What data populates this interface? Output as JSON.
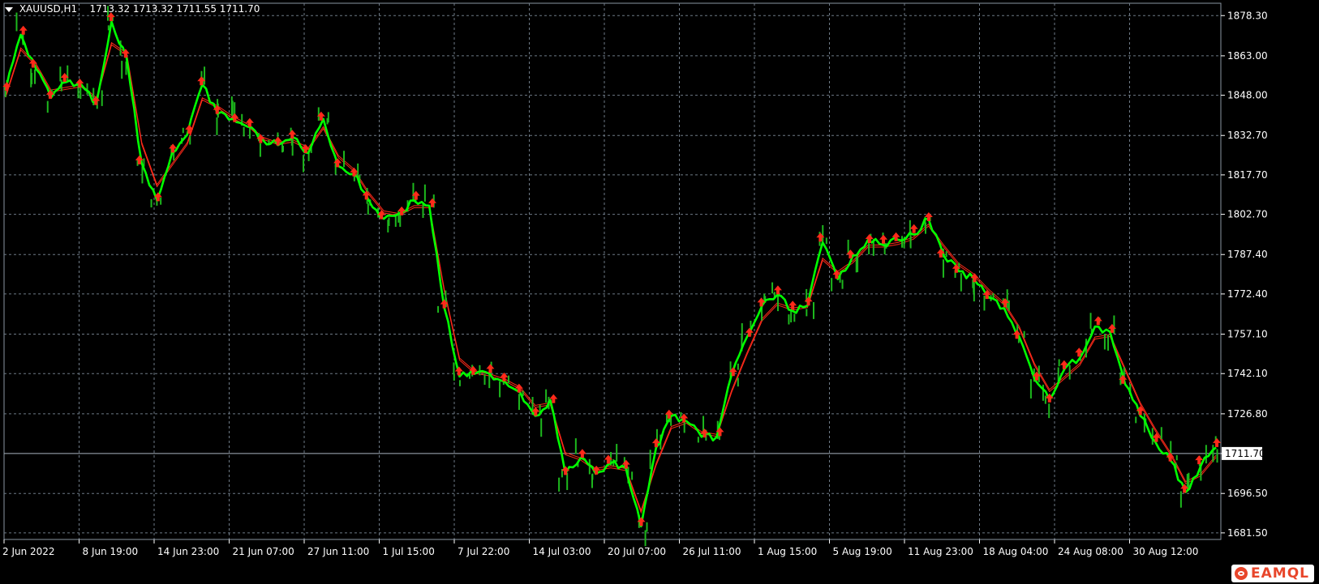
{
  "header": {
    "symbol": "XAUUSD,H1",
    "ohlc": "1713.32 1713.32 1711.55 1711.70"
  },
  "logo": {
    "text": "EAMQL"
  },
  "colors": {
    "background": "#000000",
    "grid": "#6e7a86",
    "axis": "#ffffff",
    "price_line": "#a9b4bf",
    "price_series": "#00ff00",
    "ma_series": "#ff2a1a",
    "arrow_markers": "#ff2a1a",
    "current_price_box": "#ffffff"
  },
  "chart_data": {
    "type": "line",
    "symbol": "XAUUSD",
    "timeframe": "H1",
    "y_ticks": [
      1878.3,
      1863.0,
      1848.0,
      1832.7,
      1817.7,
      1802.7,
      1787.4,
      1772.4,
      1757.1,
      1742.1,
      1726.8,
      1711.7,
      1696.5,
      1681.5
    ],
    "y_tick_labels": [
      "1878.30",
      "1863.00",
      "1848.00",
      "1832.70",
      "1817.70",
      "1802.70",
      "1787.40",
      "1772.40",
      "1757.10",
      "1742.10",
      "1726.80",
      "1711.70",
      "1696.50",
      "1681.50"
    ],
    "ylim": [
      1679.0,
      1883.0
    ],
    "x_tick_labels": [
      "2 Jun 2022",
      "8 Jun 19:00",
      "14 Jun 23:00",
      "21 Jun 07:00",
      "27 Jun 11:00",
      "1 Jul 15:00",
      "7 Jul 22:00",
      "14 Jul 03:00",
      "20 Jul 07:00",
      "26 Jul 11:00",
      "1 Aug 15:00",
      "5 Aug 19:00",
      "11 Aug 23:00",
      "18 Aug 04:00",
      "24 Aug 08:00",
      "30 Aug 12:00"
    ],
    "current_price": 1711.7,
    "current_price_label": "1711.70",
    "grid": true,
    "series": [
      {
        "role": "price",
        "x": [
          "2 Jun 2022",
          "3 Jun",
          "5 Jun",
          "6 Jun",
          "7 Jun",
          "8 Jun 19:00",
          "9 Jun",
          "10 Jun",
          "10 Jun",
          "12 Jun",
          "13 Jun",
          "14 Jun 23:00",
          "15 Jun",
          "16 Jun",
          "17 Jun",
          "19 Jun",
          "21 Jun 07:00",
          "22 Jun",
          "23 Jun",
          "24 Jun",
          "26 Jun",
          "27 Jun 11:00",
          "28 Jun",
          "29 Jun",
          "30 Jun",
          "1 Jul 15:00",
          "1 Jul",
          "2 Jul",
          "3 Jul",
          "5 Jul",
          "6 Jul",
          "7 Jul 22:00",
          "8 Jul",
          "10 Jul",
          "11 Jul",
          "12 Jul",
          "13 Jul",
          "14 Jul 03:00",
          "15 Jul",
          "17 Jul",
          "18 Jul",
          "19 Jul",
          "20 Jul 07:00",
          "21 Jul",
          "22 Jul",
          "24 Jul",
          "25 Jul",
          "26 Jul 11:00",
          "27 Jul",
          "28 Jul",
          "29 Jul",
          "31 Jul",
          "1 Aug 15:00",
          "2 Aug",
          "3 Aug",
          "4 Aug",
          "5 Aug 19:00",
          "7 Aug",
          "8 Aug",
          "9 Aug",
          "10 Aug",
          "11 Aug 23:00",
          "12 Aug",
          "14 Aug",
          "15 Aug",
          "16 Aug",
          "17 Aug",
          "18 Aug 04:00",
          "19 Aug",
          "21 Aug",
          "22 Aug",
          "23 Aug",
          "24 Aug 08:00",
          "25 Aug",
          "26 Aug",
          "28 Aug",
          "29 Aug",
          "30 Aug 12:00",
          "31 Aug",
          "1 Sep",
          "1 Sep"
        ],
        "values": [
          1850,
          1871,
          1858,
          1847,
          1853,
          1852,
          1845,
          1876,
          1862,
          1822,
          1808,
          1826,
          1833,
          1852,
          1841,
          1839,
          1836,
          1831,
          1829,
          1832,
          1826,
          1839,
          1821,
          1818,
          1808,
          1801,
          1803,
          1808,
          1806,
          1767,
          1741,
          1742,
          1742,
          1739,
          1735,
          1726,
          1732,
          1704,
          1710,
          1704,
          1708,
          1706,
          1684,
          1714,
          1726,
          1724,
          1718,
          1718,
          1742,
          1756,
          1768,
          1772,
          1766,
          1768,
          1792,
          1778,
          1787,
          1793,
          1791,
          1793,
          1795,
          1801,
          1787,
          1781,
          1778,
          1771,
          1767,
          1756,
          1740,
          1732,
          1744,
          1748,
          1760,
          1758,
          1738,
          1726,
          1716,
          1709,
          1697,
          1707,
          1714
        ]
      },
      {
        "role": "moving-average",
        "values": [
          1848,
          1866,
          1860,
          1850,
          1851,
          1852,
          1847,
          1868,
          1864,
          1830,
          1814,
          1822,
          1830,
          1847,
          1844,
          1840,
          1837,
          1832,
          1830,
          1831,
          1828,
          1836,
          1825,
          1820,
          1811,
          1804,
          1803,
          1806,
          1806,
          1774,
          1748,
          1743,
          1742,
          1740,
          1737,
          1730,
          1731,
          1712,
          1710,
          1706,
          1707,
          1706,
          1690,
          1708,
          1722,
          1724,
          1720,
          1719,
          1736,
          1750,
          1763,
          1769,
          1767,
          1768,
          1786,
          1781,
          1785,
          1791,
          1791,
          1792,
          1794,
          1799,
          1791,
          1784,
          1780,
          1774,
          1769,
          1760,
          1746,
          1736,
          1741,
          1746,
          1756,
          1757,
          1744,
          1731,
          1721,
          1712,
          1701,
          1704,
          1711
        ]
      }
    ]
  }
}
